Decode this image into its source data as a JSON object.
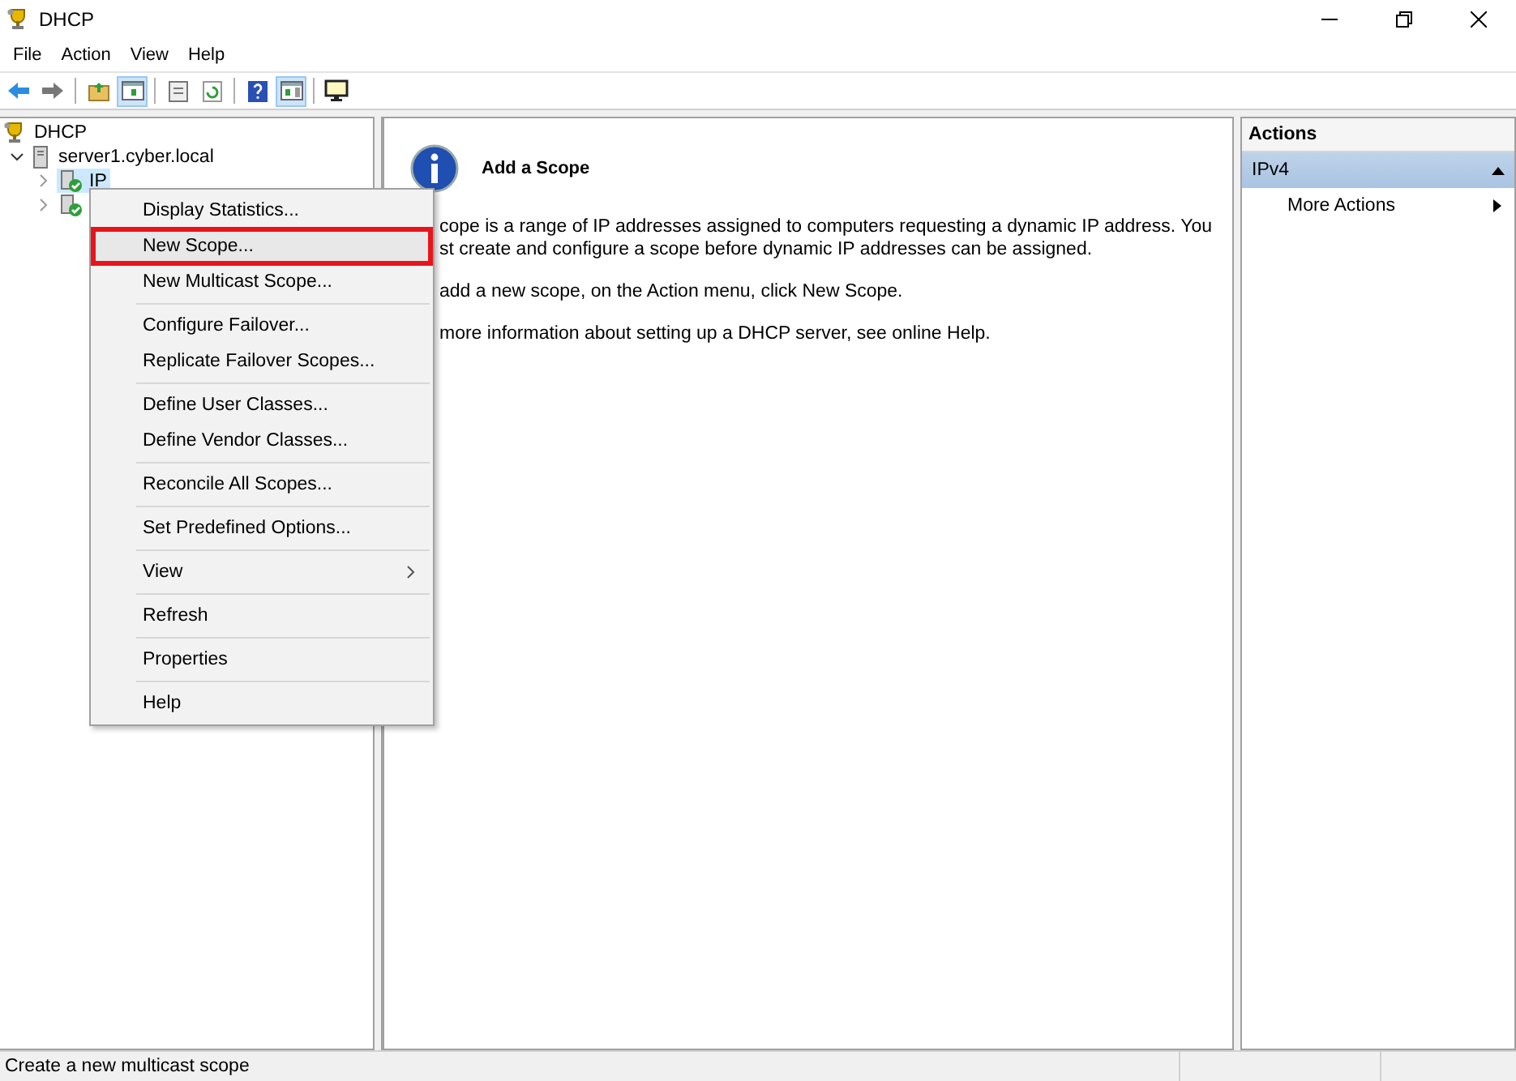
{
  "window": {
    "title": "DHCP"
  },
  "menu_bar": [
    "File",
    "Action",
    "View",
    "Help"
  ],
  "toolbar": [
    {
      "kind": "back",
      "pressed": false
    },
    {
      "kind": "forward",
      "pressed": false
    },
    {
      "kind": "sep"
    },
    {
      "kind": "folder-up",
      "pressed": false
    },
    {
      "kind": "pane",
      "pressed": true
    },
    {
      "kind": "sep"
    },
    {
      "kind": "export",
      "pressed": false
    },
    {
      "kind": "refresh",
      "pressed": false
    },
    {
      "kind": "sep"
    },
    {
      "kind": "help",
      "pressed": false
    },
    {
      "kind": "pane-right",
      "pressed": true
    },
    {
      "kind": "sep"
    },
    {
      "kind": "monitor",
      "pressed": false
    }
  ],
  "tree": [
    {
      "label": "DHCP",
      "kind": "root",
      "children": [
        {
          "label": "server1.cyber.local",
          "kind": "server",
          "expanded": true,
          "children": [
            {
              "label": "IP",
              "kind": "scope",
              "selected": true,
              "expanded": false
            },
            {
              "kind": "scope",
              "selected": false,
              "expanded": false
            }
          ]
        }
      ]
    }
  ],
  "content": {
    "title": "Add a Scope",
    "paragraphs": [
      [
        "cope is a range of IP addresses assigned to computers requesting a dynamic IP address. You",
        "st create and configure a scope before dynamic IP addresses can be assigned."
      ],
      [
        "add a new scope, on the Action menu, click New Scope."
      ],
      [
        "more information about setting up a DHCP server, see online Help."
      ]
    ]
  },
  "actions": {
    "title": "Actions",
    "section": {
      "label": "IPv4",
      "expanded": true
    },
    "items": [
      {
        "label": "More Actions",
        "submenu": true
      }
    ]
  },
  "context_menu": {
    "groups": [
      [
        {
          "label": "Display Statistics...",
          "highlighted": false,
          "submenu": false
        },
        {
          "label": "New Scope...",
          "highlighted": true,
          "submenu": false
        },
        {
          "label": "New Multicast Scope...",
          "highlighted": false,
          "submenu": false
        }
      ],
      [
        {
          "label": "Configure Failover...",
          "highlighted": false,
          "submenu": false
        },
        {
          "label": "Replicate Failover Scopes...",
          "highlighted": false,
          "submenu": false
        }
      ],
      [
        {
          "label": "Define User Classes...",
          "highlighted": false,
          "submenu": false
        },
        {
          "label": "Define Vendor Classes...",
          "highlighted": false,
          "submenu": false
        }
      ],
      [
        {
          "label": "Reconcile All Scopes...",
          "highlighted": false,
          "submenu": false
        }
      ],
      [
        {
          "label": "Set Predefined Options...",
          "highlighted": false,
          "submenu": false
        }
      ],
      [
        {
          "label": "View",
          "highlighted": false,
          "submenu": true
        }
      ],
      [
        {
          "label": "Refresh",
          "highlighted": false,
          "submenu": false
        }
      ],
      [
        {
          "label": "Properties",
          "highlighted": false,
          "submenu": false
        }
      ],
      [
        {
          "label": "Help",
          "highlighted": false,
          "submenu": false
        }
      ]
    ]
  },
  "status_bar": {
    "text": "Create a new multicast scope"
  }
}
